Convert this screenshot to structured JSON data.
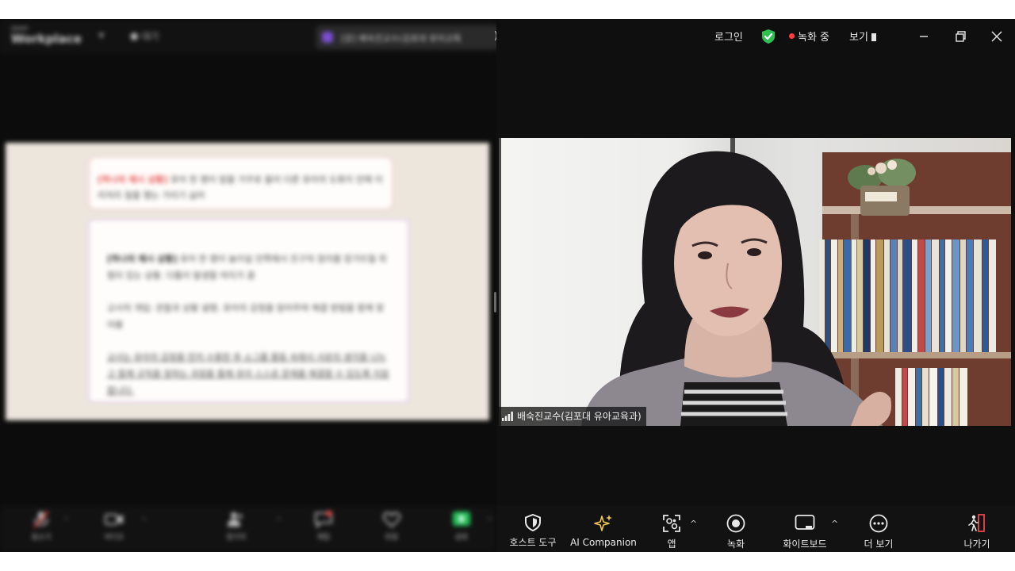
{
  "left_panel": {
    "brand_top": "zoom",
    "brand_name": "Workplace",
    "status_text": "대기",
    "meeting_title": "[강] 배숙진교수(김포대 유아교육",
    "slide": {
      "callout1_highlight": "[하나의 예시 상황]",
      "callout1_text": " 유아 한 명이 밥을 거꾸로 들어 다른 유아의 도화지 안에 이리저리 칠을 했는 가리기 싫어",
      "callout2_heading": "[하나의 예시 상황]",
      "callout2_line1": " 유아 한 명이 놀이실 안쪽에서 친구의 정리를 망가뜨릴 위험이 있는 상황. 다툼이 발생할 여지가 큼",
      "callout2_line2": "교사의 개입: 관찰과 상황 설명, 유아의 감정을 읽어주며 해결 방법을 함께 찾아봄",
      "callout2_line3": "교사는 유아의 감정을 먼저 수용한 후 소그룹 활동 속에서 서로의 생각을 나누고 함께 규칙을 정하는 과정을 통해 유아 스스로 문제를 해결할 수 있도록 지원합니다."
    },
    "toolbar": [
      "음소거",
      "비디오",
      "참가자",
      "채팅",
      "반응",
      "공유"
    ]
  },
  "titlebar": {
    "login": "로그인",
    "recording": "녹화 중",
    "view": "보기"
  },
  "video": {
    "participant_name": "배숙진교수(김포대 유아교육과)"
  },
  "toolbar": {
    "host_tools": "호스트 도구",
    "ai_companion": "AI Companion",
    "apps": "앱",
    "record": "녹화",
    "whiteboard": "화이트보드",
    "more": "더 보기",
    "leave": "나가기"
  },
  "colors": {
    "background": "#0f0f0f",
    "recording_dot": "#ff3b3b",
    "shield_green": "#2fbf52",
    "ai_star": "#f5c84c",
    "leave_red": "#e5484d"
  }
}
